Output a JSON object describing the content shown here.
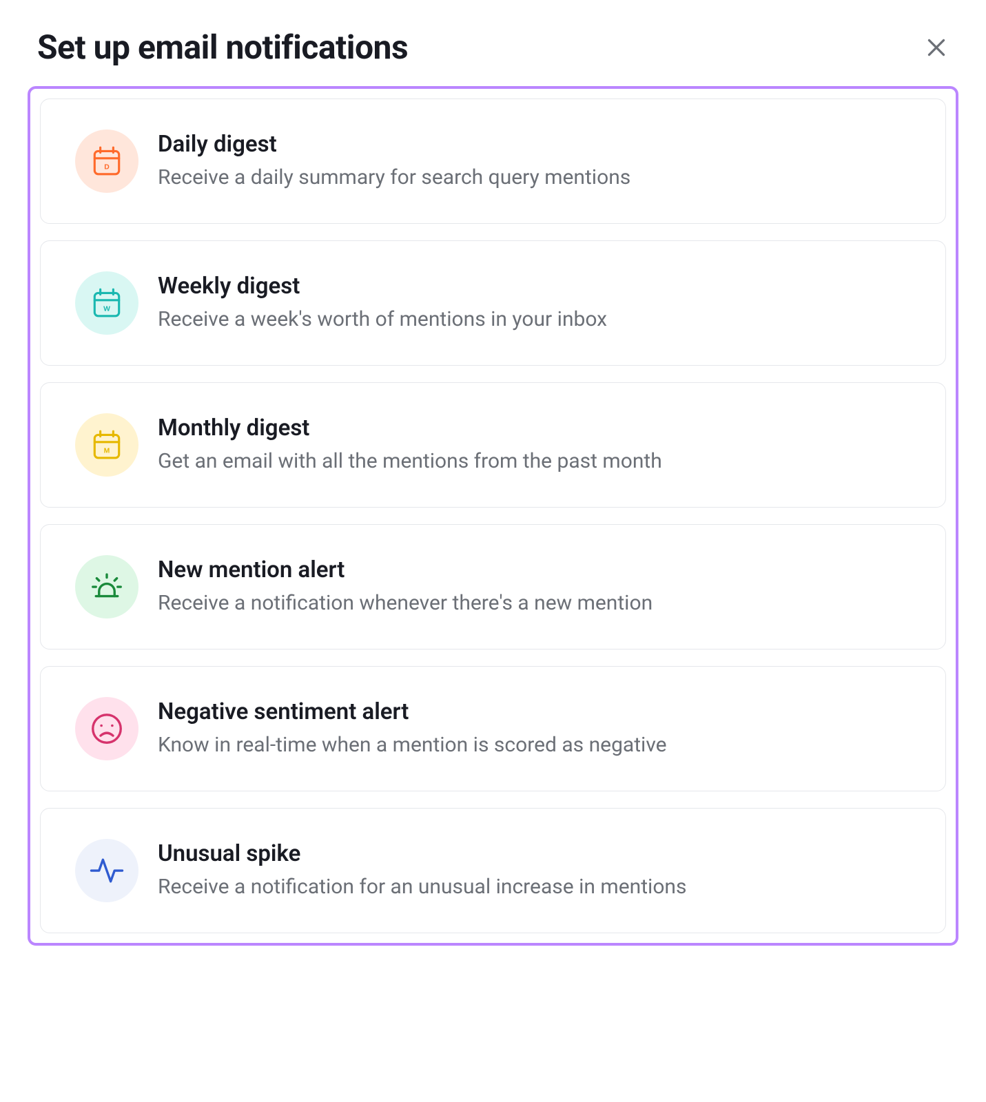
{
  "header": {
    "title": "Set up email notifications"
  },
  "items": [
    {
      "title": "Daily digest",
      "desc": "Receive a daily summary for search query mentions"
    },
    {
      "title": "Weekly digest",
      "desc": "Receive a week's worth of mentions in your inbox"
    },
    {
      "title": "Monthly digest",
      "desc": "Get an email with all the mentions from the past month"
    },
    {
      "title": "New mention alert",
      "desc": "Receive a notification whenever there's a new mention"
    },
    {
      "title": "Negative sentiment alert",
      "desc": "Know in real-time when a mention is scored as negative"
    },
    {
      "title": "Unusual spike",
      "desc": "Receive a notification for an unusual increase in mentions"
    }
  ],
  "colors": {
    "accent_border": "#bb86ff",
    "text_primary": "#191b23",
    "text_secondary": "#6b6f76",
    "orange": "#ff6a2b",
    "teal": "#1ab8b0",
    "yellow": "#e6b800",
    "green": "#1a8a3b",
    "pink": "#d6336c",
    "blue": "#2f5bd0"
  }
}
